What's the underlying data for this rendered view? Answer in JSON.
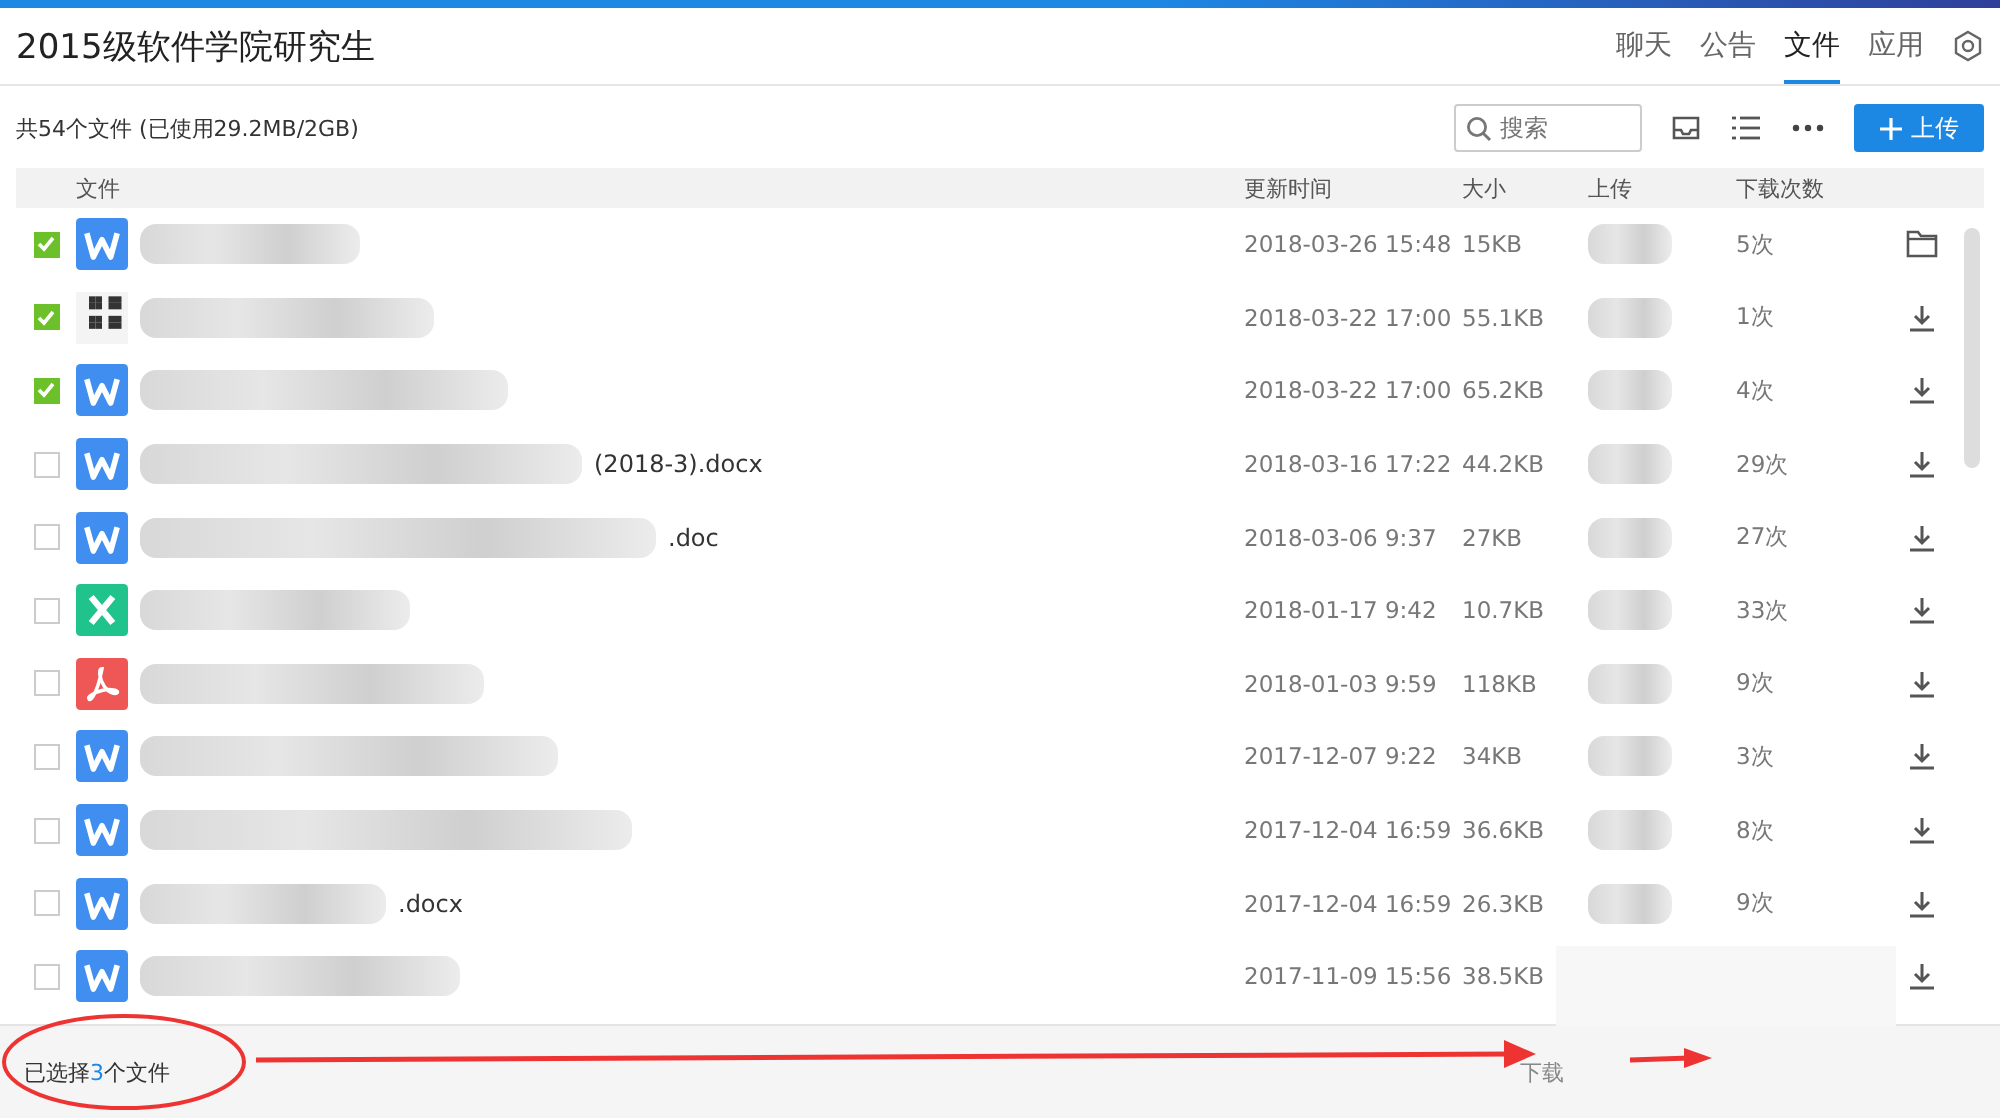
{
  "window": {
    "title": "2015级软件学院研究生"
  },
  "tabs": [
    {
      "label": "聊天",
      "selected": false
    },
    {
      "label": "公告",
      "selected": false
    },
    {
      "label": "文件",
      "selected": true
    },
    {
      "label": "应用",
      "selected": false
    }
  ],
  "summary": "共54个文件 (已使用29.2MB/2GB)",
  "search": {
    "placeholder": "搜索"
  },
  "upload_button": "上传",
  "table": {
    "columns": [
      "文件",
      "更新时间",
      "大小",
      "上传",
      "下载次数"
    ],
    "rows": [
      {
        "selected": true,
        "file_icon": {
          "kind": "word"
        },
        "time": "2018-03-26 15:48",
        "size": "15KB",
        "downloads": "5次",
        "action_icon": {
          "kind": "folder"
        }
      },
      {
        "selected": true,
        "file_icon": {
          "kind": "image"
        },
        "time": "2018-03-22 17:00",
        "size": "55.1KB",
        "downloads": "1次",
        "action_icon": {
          "kind": "download"
        }
      },
      {
        "selected": true,
        "file_icon": {
          "kind": "word"
        },
        "time": "2018-03-22 17:00",
        "size": "65.2KB",
        "downloads": "4次",
        "action_icon": {
          "kind": "download"
        }
      },
      {
        "selected": false,
        "file_icon": {
          "kind": "word"
        },
        "name": "(2018-3).docx",
        "time": "2018-03-16 17:22",
        "size": "44.2KB",
        "downloads": "29次",
        "action_icon": {
          "kind": "download"
        }
      },
      {
        "selected": false,
        "file_icon": {
          "kind": "word"
        },
        "name": ".doc",
        "time": "2018-03-06 9:37",
        "size": "27KB",
        "downloads": "27次",
        "action_icon": {
          "kind": "download"
        }
      },
      {
        "selected": false,
        "file_icon": {
          "kind": "excel"
        },
        "time": "2018-01-17 9:42",
        "size": "10.7KB",
        "downloads": "33次",
        "action_icon": {
          "kind": "download"
        }
      },
      {
        "selected": false,
        "file_icon": {
          "kind": "pdf"
        },
        "time": "2018-01-03 9:59",
        "size": "118KB",
        "downloads": "9次",
        "action_icon": {
          "kind": "download"
        }
      },
      {
        "selected": false,
        "file_icon": {
          "kind": "word"
        },
        "time": "2017-12-07 9:22",
        "size": "34KB",
        "downloads": "3次",
        "action_icon": {
          "kind": "download"
        }
      },
      {
        "selected": false,
        "file_icon": {
          "kind": "word"
        },
        "time": "2017-12-04 16:59",
        "size": "36.6KB",
        "downloads": "8次",
        "action_icon": {
          "kind": "download"
        }
      },
      {
        "selected": false,
        "file_icon": {
          "kind": "word"
        },
        "name": ".docx",
        "time": "2017-12-04 16:59",
        "size": "26.3KB",
        "downloads": "9次",
        "action_icon": {
          "kind": "download"
        }
      },
      {
        "selected": false,
        "file_icon": {
          "kind": "word"
        },
        "time": "2017-11-09 15:56",
        "size": "38.5KB",
        "action_icon": {
          "kind": "download"
        }
      }
    ]
  },
  "footer": {
    "selection_prefix": "已选择",
    "selection_count": "3",
    "selection_suffix": "个文件",
    "download_button": "下载"
  }
}
